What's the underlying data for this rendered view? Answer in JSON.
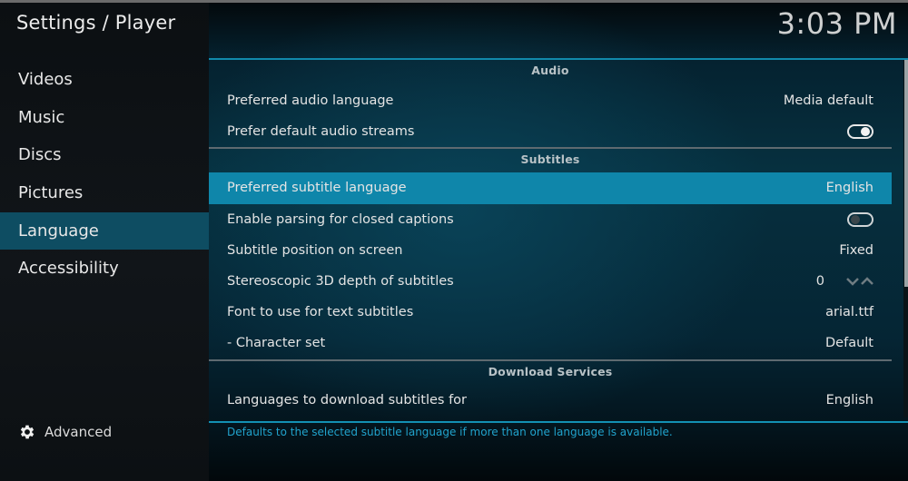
{
  "header": {
    "title": "Settings / Player",
    "clock": "3:03 PM"
  },
  "sidebar": {
    "items": [
      {
        "label": "Videos",
        "active": false
      },
      {
        "label": "Music",
        "active": false
      },
      {
        "label": "Discs",
        "active": false
      },
      {
        "label": "Pictures",
        "active": false
      },
      {
        "label": "Language",
        "active": true
      },
      {
        "label": "Accessibility",
        "active": false
      }
    ],
    "advanced": {
      "label": "Advanced",
      "icon": "gear-icon"
    }
  },
  "settings": {
    "sections": [
      {
        "title": "Audio",
        "rows": [
          {
            "label": "Preferred audio language",
            "value": "Media default",
            "type": "value"
          },
          {
            "label": "Prefer default audio streams",
            "value": "on",
            "type": "toggle"
          }
        ]
      },
      {
        "title": "Subtitles",
        "rows": [
          {
            "label": "Preferred subtitle language",
            "value": "English",
            "type": "value",
            "selected": true
          },
          {
            "label": "Enable parsing for closed captions",
            "value": "off",
            "type": "toggle"
          },
          {
            "label": "Subtitle position on screen",
            "value": "Fixed",
            "type": "value"
          },
          {
            "label": "Stereoscopic 3D depth of subtitles",
            "value": "0",
            "type": "spinner"
          },
          {
            "label": "Font to use for text subtitles",
            "value": "arial.ttf",
            "type": "value"
          },
          {
            "label": "- Character set",
            "value": "Default",
            "type": "value"
          }
        ]
      },
      {
        "title": "Download Services",
        "rows": [
          {
            "label": "Languages to download subtitles for",
            "value": "English",
            "type": "value"
          }
        ]
      }
    ]
  },
  "description": "Defaults to the selected subtitle language if more than one language is available.",
  "colors": {
    "accent": "#0f86aa",
    "sidebar_active": "#0e4d62",
    "description_text": "#21a3cc"
  }
}
